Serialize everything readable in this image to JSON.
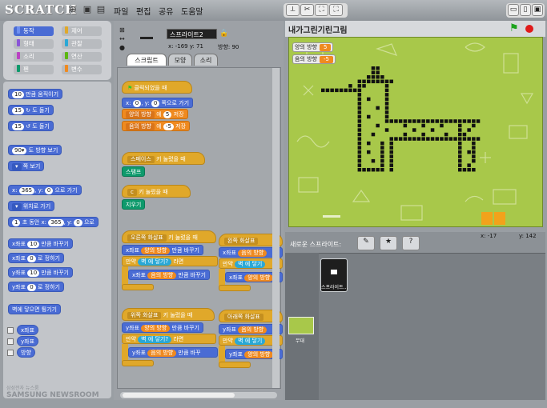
{
  "app": {
    "logo": "SCRATCH",
    "menu": [
      "파일",
      "편집",
      "공유",
      "도움말"
    ],
    "tools": [
      "⟂",
      "✂",
      "⛶",
      "⛶"
    ]
  },
  "categories": [
    {
      "label": "동작",
      "color": "#4a6cd4"
    },
    {
      "label": "제어",
      "color": "#e0a82a"
    },
    {
      "label": "형태",
      "color": "#8a55d7"
    },
    {
      "label": "관찰",
      "color": "#2aa8d6"
    },
    {
      "label": "소리",
      "color": "#bb42c3"
    },
    {
      "label": "연산",
      "color": "#5cb712"
    },
    {
      "label": "펜",
      "color": "#0e9a6c"
    },
    {
      "label": "변수",
      "color": "#ef8a20"
    }
  ],
  "palette": {
    "b1": "10",
    "b1t": "만큼 움직이기",
    "b2": "15",
    "b2t": "도 돌기",
    "b3": "15",
    "b3t": "도 돌기",
    "b4": "90▾",
    "b4t": "도 방향 보기",
    "b5t": "쪽 보기",
    "b6a": "x:",
    "b6b": "365",
    "b6c": ", y:",
    "b6d": "0",
    "b6e": "으로 가기",
    "b7t": "위치로 가기",
    "b8a": "1",
    "b8b": "초 동안 x:",
    "b8c": "365",
    "b8d": ", y:",
    "b8e": "0",
    "b8f": "으로",
    "b9a": "x좌표",
    "b9b": "10",
    "b9c": "만큼 바꾸기",
    "b10a": "x좌표",
    "b10b": "0",
    "b10c": "로 정하기",
    "b11a": "y좌표",
    "b11b": "10",
    "b11c": "만큼 바꾸기",
    "b12a": "y좌표",
    "b12b": "0",
    "b12c": "로 정하기",
    "b13": "벽에 닿으면 튕기기",
    "r1": "x좌표",
    "r2": "y좌표",
    "r3": "방향"
  },
  "sprite": {
    "name": "스프라이트2",
    "coords": "x: -169  y: 71",
    "dir": "방향: 90"
  },
  "tabs": [
    "스크립트",
    "모양",
    "소리"
  ],
  "scripts": {
    "h1": "클릭되었을 때",
    "s1a": "x:",
    "s1b": "0",
    "s1c": ", y:",
    "s1d": "0",
    "s1e": "쪽으로 가기",
    "s2a": "양의 방향",
    "s2b": "에",
    "s2c": "5",
    "s2d": "저장",
    "s3a": "음의 방향",
    "s3b": "에",
    "s3c": "-5",
    "s3d": "저장",
    "h2a": "스페이스",
    "h2b": "키 눌렀을 때",
    "s4": "스탬프",
    "h3a": "c",
    "h3b": "키 눌렀을 때",
    "s5": "지우기",
    "h4a": "오른쪽 화살표",
    "h4b": "키 눌렀을 때",
    "s6a": "x좌표",
    "s6b": "양의 방향",
    "s6c": "만큼 바꾸기",
    "s7a": "만약",
    "s7b": "벽",
    "s7c": "에 닿기?",
    "s7d": "라면",
    "s8a": "x좌표",
    "s8b": "음의 방향",
    "s8c": "만큼 바꾸기",
    "h5a": "왼쪽 화살표",
    "h5b": "키 눌렀을 때",
    "s9a": "x좌표",
    "s9b": "음의 방향",
    "s10a": "만약",
    "s10b": "벽",
    "s10c": "에 닿기",
    "s11a": "x좌표",
    "s11b": "양의 방향",
    "h6a": "위쪽 화살표",
    "h6b": "키 눌렀을 때",
    "s12a": "y좌표",
    "s12b": "양의 방향",
    "s12c": "만큼 바꾸기",
    "s13a": "만약",
    "s13b": "벽",
    "s13c": "에 닿기?",
    "s13d": "라면",
    "s14a": "y좌표",
    "s14b": "음의 방향",
    "s14c": "만큼 바꾸",
    "h7a": "아래쪽 화살표",
    "h7b": "키 눌렀을",
    "s15a": "y좌표",
    "s15b": "음의 방향",
    "s16a": "만약",
    "s16b": "벽",
    "s16c": "에 닿기",
    "s17a": "y좌표",
    "s17b": "양의 방향"
  },
  "stage": {
    "title": "내가그린기린그림",
    "mon1": {
      "label": "양의 방향",
      "value": "5"
    },
    "mon2": {
      "label": "음의 방향",
      "value": "-5"
    },
    "coords_x": "x: -17",
    "coords_y": "y: 142"
  },
  "sprites": {
    "new_label": "새로운 스프라이트:",
    "thumb": "스프라이트...",
    "stage": "무대"
  },
  "watermark": {
    "line1": "삼성전자 뉴스룸",
    "line2": "SAMSUNG NEWSROOM"
  }
}
